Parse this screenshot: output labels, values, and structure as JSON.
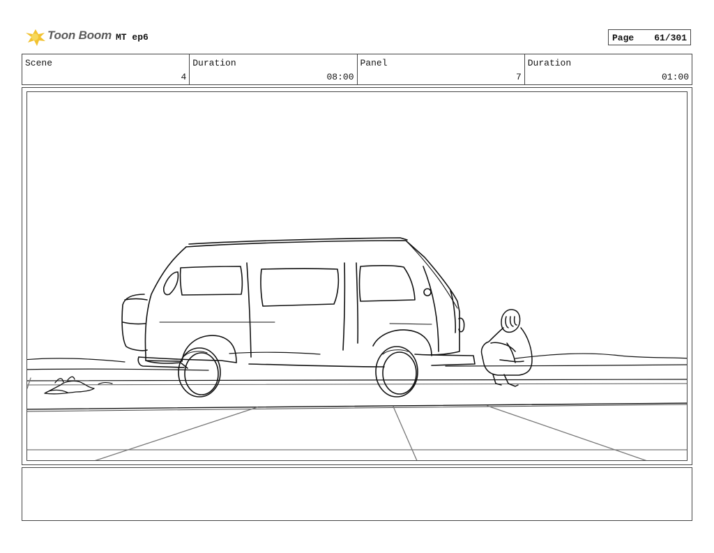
{
  "header": {
    "logo_text": "Toon Boom",
    "project": "MT ep6",
    "page_label": "Page",
    "page_value": "61/301"
  },
  "info": [
    {
      "label": "Scene",
      "value": "4"
    },
    {
      "label": "Duration",
      "value": "08:00"
    },
    {
      "label": "Panel",
      "value": "7"
    },
    {
      "label": "Duration",
      "value": "01:00"
    }
  ],
  "notes": {
    "text": ""
  }
}
